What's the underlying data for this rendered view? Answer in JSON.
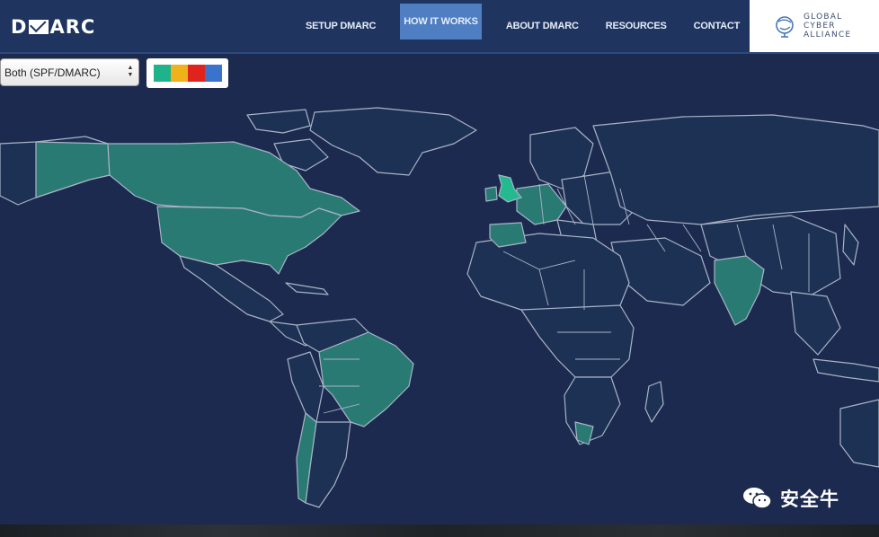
{
  "header": {
    "logo_left": "D",
    "logo_right": "ARC",
    "nav": [
      {
        "label": "SETUP DMARC",
        "active": false
      },
      {
        "label": "HOW IT WORKS",
        "active": true
      },
      {
        "label": "ABOUT DMARC",
        "active": false
      },
      {
        "label": "RESOURCES",
        "active": false
      },
      {
        "label": "CONTACT",
        "active": false
      }
    ],
    "partner": {
      "line1": "GLOBAL",
      "line2": "CYBER",
      "line3": "ALLIANCE",
      "icon": "globe-logo-icon"
    }
  },
  "controls": {
    "filter_value": "Both (SPF/DMARC)",
    "legend_colors": [
      "#1fb38d",
      "#f0b21a",
      "#e0241d",
      "#3a73cc"
    ]
  },
  "map": {
    "ocean_color": "#1b2a4e",
    "land_color": "#1d3155",
    "border_color": "#a9b3c6",
    "highlight_color": "#2a7a74",
    "strong_highlight_color": "#25b98f"
  },
  "watermark": {
    "text": "安全牛",
    "icon": "wechat-icon"
  }
}
